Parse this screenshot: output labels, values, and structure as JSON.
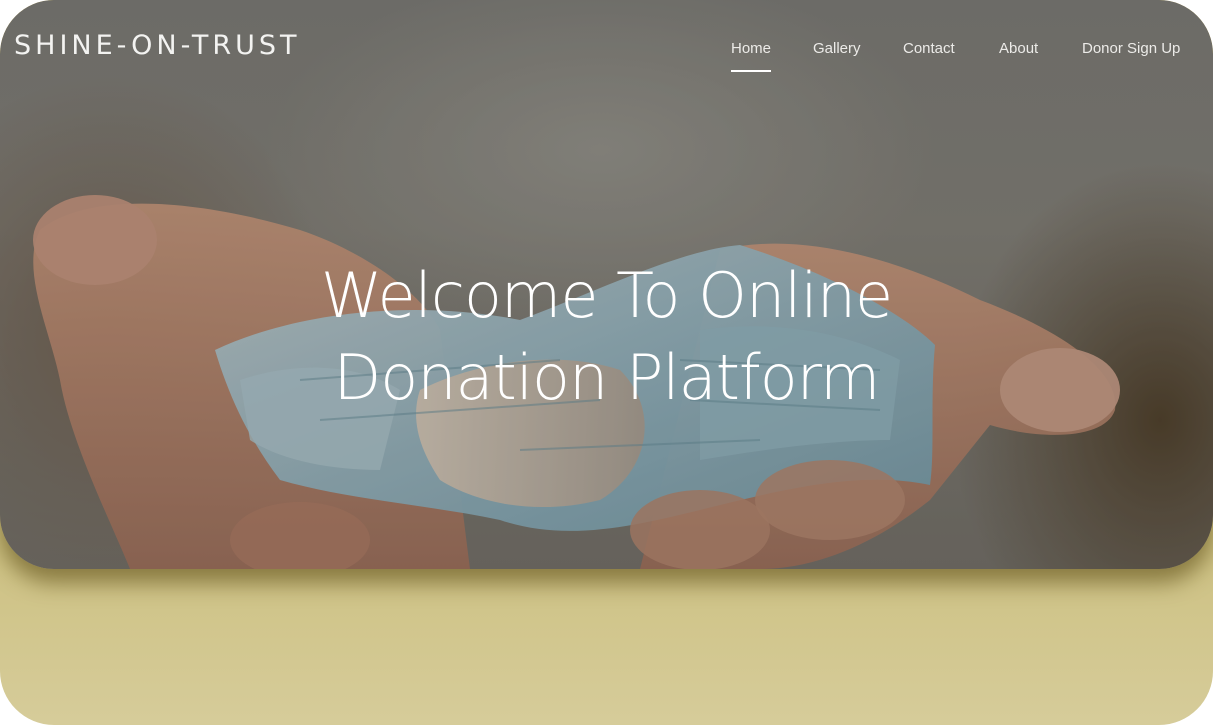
{
  "brand": {
    "name": "SHINE-ON-TRUST"
  },
  "nav": {
    "items": [
      {
        "label": "Home",
        "active": true
      },
      {
        "label": "Gallery",
        "active": false
      },
      {
        "label": "Contact",
        "active": false
      },
      {
        "label": "About",
        "active": false
      },
      {
        "label": "Donor Sign Up",
        "active": false
      }
    ]
  },
  "hero": {
    "headline_line1": "Welcome To Online",
    "headline_line2": "Donation Platform",
    "image_subject": "hands-holding-euro-banknotes"
  },
  "colors": {
    "page_gradient_top": "#b9a44c",
    "page_gradient_bottom": "#d6cc9a",
    "text_light": "#ffffff"
  }
}
